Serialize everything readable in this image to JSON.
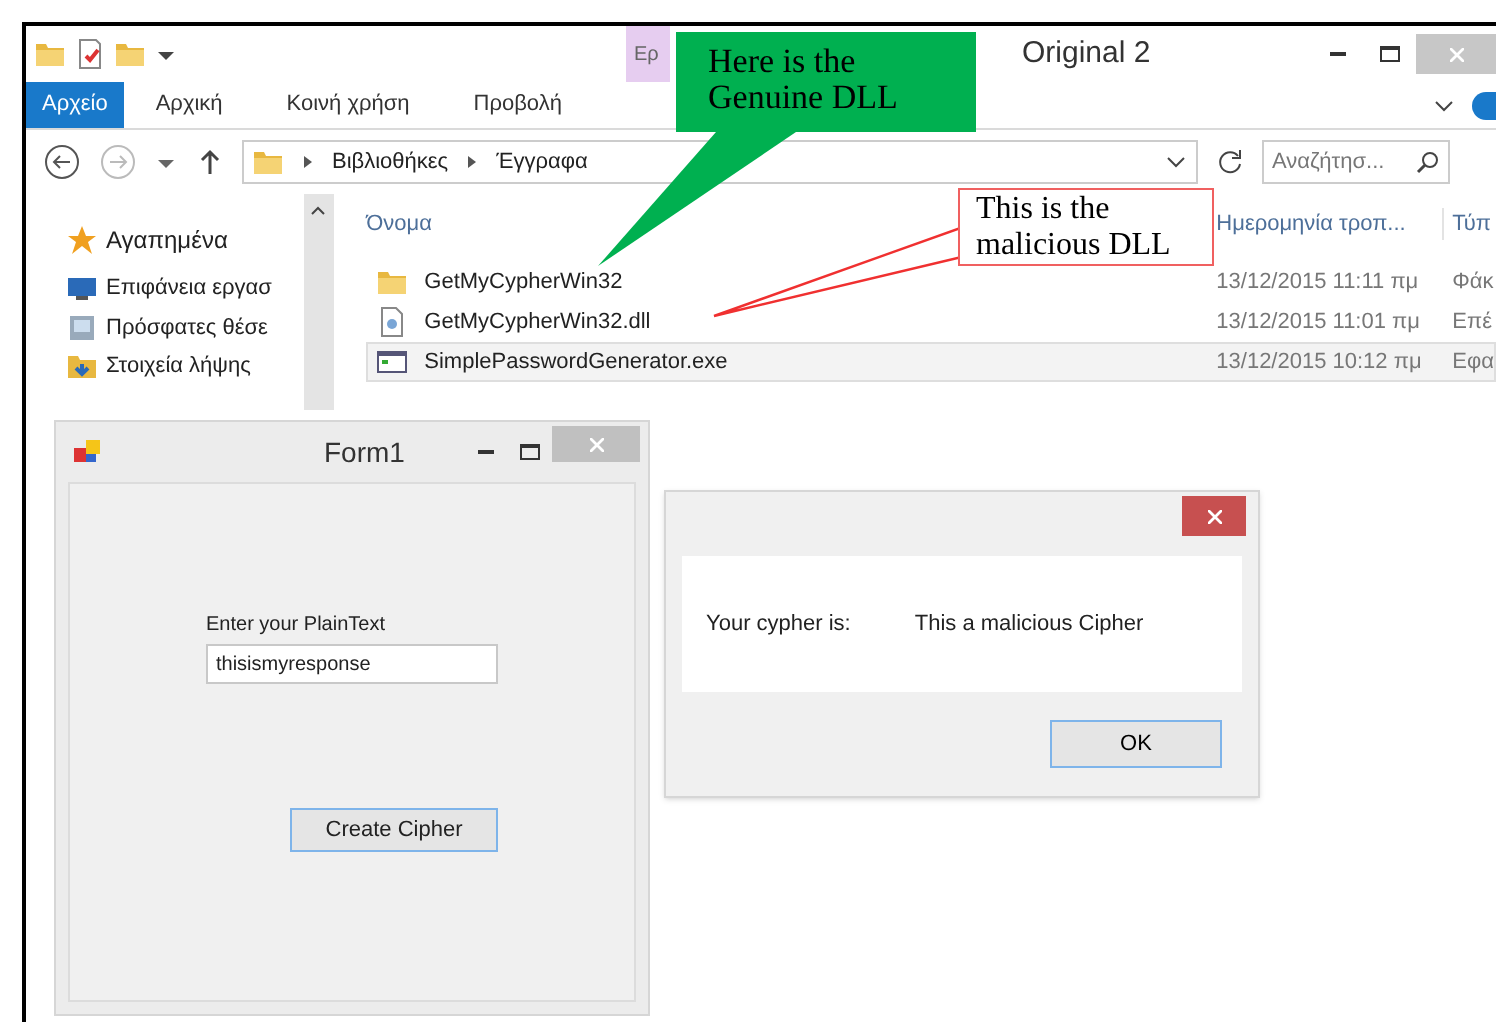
{
  "explorer": {
    "context_tab": "Ερ",
    "title": "Original 2",
    "ribbon_tabs": [
      {
        "label": "Αρχείο",
        "selected": true
      },
      {
        "label": "Αρχική",
        "selected": false
      },
      {
        "label": "Κοινή χρήση",
        "selected": false
      },
      {
        "label": "Προβολή",
        "selected": false
      }
    ],
    "breadcrumb": [
      "Βιβλιοθήκες",
      "Έγγραφα"
    ],
    "search": {
      "placeholder": "Αναζήτησ..."
    },
    "nav": [
      {
        "label": "Αγαπημένα",
        "kind": "star"
      },
      {
        "label": "Επιφάνεια εργασ",
        "kind": "desktop"
      },
      {
        "label": "Πρόσφατες θέσε",
        "kind": "recent"
      },
      {
        "label": "Στοιχεία λήψης",
        "kind": "downloads"
      }
    ],
    "columns": [
      "Όνομα",
      "Ημερομηνία τροπ...",
      "Τύπ"
    ],
    "files": [
      {
        "name": "GetMyCypherWin32",
        "date": "13/12/2015 11:11 πμ",
        "type": "Φάκ",
        "kind": "folder",
        "selected": false
      },
      {
        "name": "GetMyCypherWin32.dll",
        "date": "13/12/2015 11:01 πμ",
        "type": "Επέ",
        "kind": "dll",
        "selected": false
      },
      {
        "name": "SimplePasswordGenerator.exe",
        "date": "13/12/2015 10:12 πμ",
        "type": "Εφα",
        "kind": "exe",
        "selected": true
      }
    ]
  },
  "form": {
    "title": "Form1",
    "label": "Enter your PlainText",
    "value": "thisismyresponse",
    "button": "Create Cipher"
  },
  "message_box": {
    "label": "Your cypher is:",
    "message": "This a malicious Cipher",
    "button": "OK"
  },
  "callouts": [
    {
      "text": "Here is the Genuine DLL",
      "kind": "green"
    },
    {
      "text": "This is the malicious DLL",
      "kind": "red"
    }
  ]
}
